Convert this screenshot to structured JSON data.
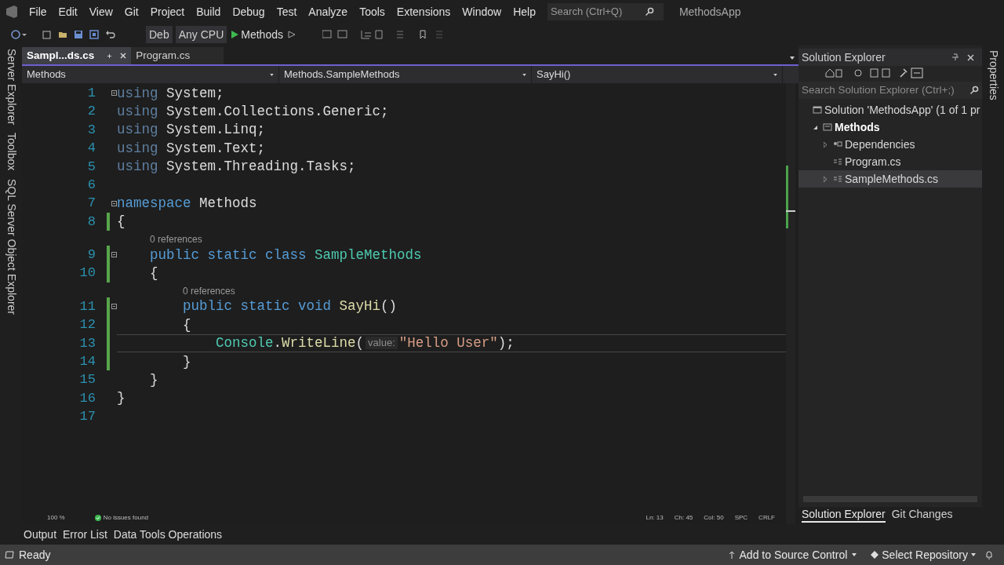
{
  "menu_bar": {
    "items": [
      "File",
      "Edit",
      "View",
      "Git",
      "Project",
      "Build",
      "Debug",
      "Test",
      "Analyze",
      "Tools",
      "Extensions",
      "Window",
      "Help"
    ],
    "search": {
      "placeholder": "Search (Ctrl+Q)"
    },
    "title": "MethodsApp"
  },
  "toolbar": {
    "configuration": "Deb",
    "platform": "Any CPU",
    "run_target": "Methods"
  },
  "left_tool_tabs": [
    "Server Explorer",
    "Toolbox",
    "SQL Server Object Explorer"
  ],
  "document_tabs": [
    {
      "label": "Sampl...ds.cs",
      "selected": true
    },
    {
      "label": "Program.cs",
      "selected": false
    }
  ],
  "navigation_bar": [
    "Methods",
    "Methods.SampleMethods",
    "SayHi()"
  ],
  "code": {
    "lines": [
      {
        "kind": "code",
        "number": "1",
        "fold": true,
        "changed": false,
        "current": false,
        "tokens": [
          {
            "kind": "faded",
            "text": "using"
          },
          {
            "kind": "plain",
            "text": " System;"
          }
        ]
      },
      {
        "kind": "code",
        "number": "2",
        "fold": false,
        "changed": false,
        "current": false,
        "tokens": [
          {
            "kind": "faded",
            "text": "using"
          },
          {
            "kind": "plain",
            "text": " System.Collections.Generic;"
          }
        ]
      },
      {
        "kind": "code",
        "number": "3",
        "fold": false,
        "changed": false,
        "current": false,
        "tokens": [
          {
            "kind": "faded",
            "text": "using"
          },
          {
            "kind": "plain",
            "text": " System.Linq;"
          }
        ]
      },
      {
        "kind": "code",
        "number": "4",
        "fold": false,
        "changed": false,
        "current": false,
        "tokens": [
          {
            "kind": "faded",
            "text": "using"
          },
          {
            "kind": "plain",
            "text": " System.Text;"
          }
        ]
      },
      {
        "kind": "code",
        "number": "5",
        "fold": false,
        "changed": false,
        "current": false,
        "tokens": [
          {
            "kind": "faded",
            "text": "using"
          },
          {
            "kind": "plain",
            "text": " System.Threading.Tasks;"
          }
        ]
      },
      {
        "kind": "code",
        "number": "6",
        "fold": false,
        "changed": false,
        "current": false
      },
      {
        "kind": "code",
        "number": "7",
        "fold": true,
        "changed": false,
        "current": false,
        "tokens": [
          {
            "kind": "keyword",
            "text": "namespace"
          },
          {
            "kind": "plain",
            "text": " Methods"
          }
        ]
      },
      {
        "kind": "code",
        "number": "8",
        "fold": false,
        "changed": true,
        "current": false,
        "tokens": [
          {
            "kind": "plain",
            "text": "{"
          }
        ]
      },
      {
        "kind": "codelens",
        "text": "0 references"
      },
      {
        "kind": "code",
        "number": "9",
        "fold": true,
        "changed": true,
        "current": false,
        "tokens": [
          {
            "kind": "keyword",
            "text": "    public static class"
          },
          {
            "kind": "type",
            "text": " SampleMethods"
          }
        ]
      },
      {
        "kind": "code",
        "number": "10",
        "fold": false,
        "changed": true,
        "current": false,
        "tokens": [
          {
            "kind": "plain",
            "text": "    {"
          }
        ]
      },
      {
        "kind": "codelens",
        "text": "0 references"
      },
      {
        "kind": "code",
        "number": "11",
        "fold": true,
        "changed": true,
        "current": false,
        "tokens": [
          {
            "kind": "keyword",
            "text": "        public static void"
          },
          {
            "kind": "method",
            "text": " SayHi"
          },
          {
            "kind": "plain",
            "text": "()"
          }
        ]
      },
      {
        "kind": "code",
        "number": "12",
        "fold": false,
        "changed": true,
        "current": false,
        "tokens": [
          {
            "kind": "plain",
            "text": "        {"
          }
        ]
      },
      {
        "kind": "code",
        "number": "13",
        "fold": false,
        "changed": true,
        "current": true,
        "tokens": [
          {
            "kind": "type",
            "text": "            Console"
          },
          {
            "kind": "plain",
            "text": "."
          },
          {
            "kind": "method",
            "text": "WriteLine"
          },
          {
            "kind": "plain",
            "text": "("
          },
          {
            "kind": "hint",
            "text": "value:"
          },
          {
            "kind": "string",
            "text": "\"Hello User\""
          },
          {
            "kind": "plain",
            "text": ");"
          }
        ]
      },
      {
        "kind": "code",
        "number": "14",
        "fold": false,
        "changed": true,
        "current": false,
        "tokens": [
          {
            "kind": "plain",
            "text": "        }"
          }
        ]
      },
      {
        "kind": "code",
        "number": "15",
        "fold": false,
        "changed": false,
        "current": false,
        "tokens": [
          {
            "kind": "plain",
            "text": "    }"
          }
        ]
      },
      {
        "kind": "code",
        "number": "16",
        "fold": false,
        "changed": false,
        "current": false,
        "tokens": [
          {
            "kind": "plain",
            "text": "}"
          }
        ]
      },
      {
        "kind": "code",
        "number": "17",
        "fold": false,
        "changed": false,
        "current": false
      }
    ]
  },
  "editor_status": {
    "zoom": "100 %",
    "issues": "No issues found",
    "line": "Ln: 13",
    "char": "Ch: 45",
    "column": "Col: 50",
    "whitespace": "SPC",
    "line_endings": "CRLF"
  },
  "solution_explorer": {
    "title": "Solution Explorer",
    "search": {
      "placeholder": "Search Solution Explorer (Ctrl+;)"
    },
    "tree": [
      {
        "label": "Solution 'MethodsApp' (1 of 1 pr",
        "kind": "solution",
        "selected": false,
        "bold": false,
        "children": [
          {
            "label": "Methods",
            "kind": "project",
            "expanded": true,
            "selected": false,
            "bold": true,
            "children": [
              {
                "label": "Dependencies",
                "kind": "dependencies",
                "expanded": false,
                "selected": false,
                "bold": false
              },
              {
                "label": "Program.cs",
                "kind": "csfile",
                "selected": false,
                "bold": false
              },
              {
                "label": "SampleMethods.cs",
                "kind": "csfile",
                "expanded": false,
                "selected": true,
                "bold": false
              }
            ]
          }
        ]
      }
    ],
    "bottom_tabs": [
      {
        "label": "Solution Explorer",
        "selected": true
      },
      {
        "label": "Git Changes",
        "selected": false
      }
    ]
  },
  "right_tool_tabs": [
    "Properties"
  ],
  "bottom_tool_tabs": [
    "Output",
    "Error List",
    "Data Tools Operations"
  ],
  "status_bar": {
    "text": "Ready",
    "source_control": "Add to Source Control",
    "repository": "Select Repository"
  }
}
